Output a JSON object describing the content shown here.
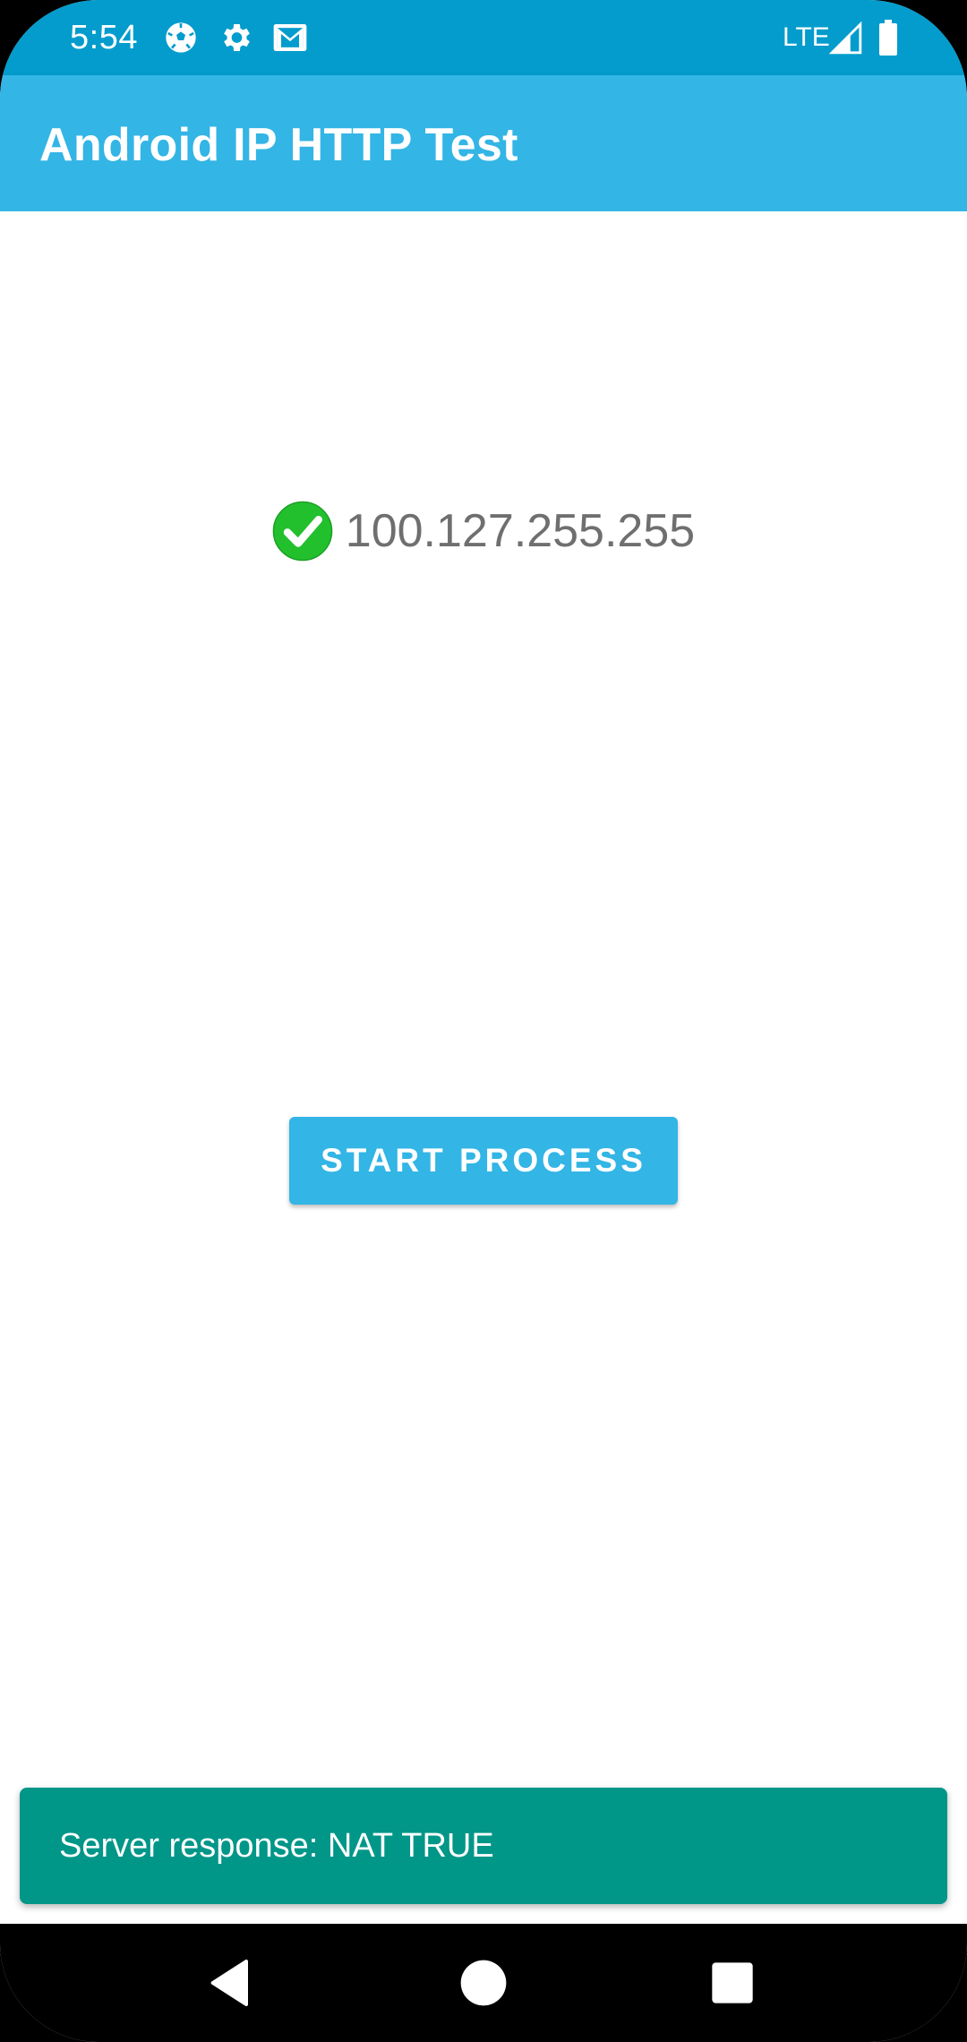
{
  "status_bar": {
    "time": "5:54",
    "icons": [
      "soccer-ball-icon",
      "gear-icon",
      "gmail-icon"
    ],
    "network_label": "LTE",
    "right_icons": [
      "signal-icon",
      "battery-icon"
    ],
    "background_color": "#039ccd"
  },
  "app_bar": {
    "title": "Android IP HTTP Test",
    "background_color": "#33b5e5"
  },
  "main": {
    "status_icon": "check-circle-icon",
    "ip_address": "100.127.255.255",
    "start_button_label": "START PROCESS",
    "accent_color": "#33b5e5"
  },
  "snackbar": {
    "message": "Server response: NAT TRUE",
    "background_color": "#009688"
  },
  "nav_bar": {
    "buttons": [
      "back-icon",
      "home-icon",
      "recents-icon"
    ]
  }
}
